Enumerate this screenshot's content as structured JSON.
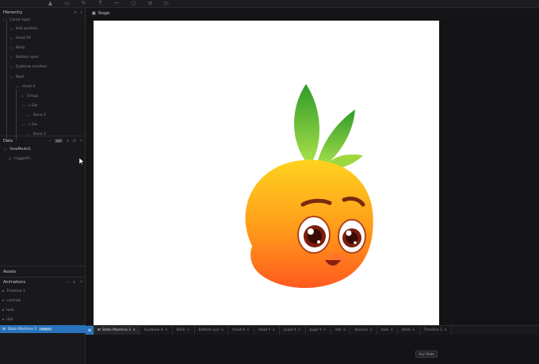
{
  "hierarchy": {
    "title": "Hierarchy",
    "items": [
      {
        "label": "Carrot topic",
        "icon": "artboard-icon"
      },
      {
        "label": "Ball position",
        "icon": "group-icon"
      },
      {
        "label": "Head XY",
        "icon": "group-icon"
      },
      {
        "label": "Body",
        "icon": "group-icon"
      },
      {
        "label": "Bottom eyes",
        "icon": "group-icon"
      },
      {
        "label": "Eyebrow emotion",
        "icon": "group-icon"
      },
      {
        "label": "Root",
        "icon": "bone-icon"
      },
      {
        "label": "Head X",
        "icon": "bone-icon"
      },
      {
        "label": "Group",
        "icon": "group-icon"
      },
      {
        "label": "L Ear",
        "icon": "bone-icon"
      },
      {
        "label": "Bone 2",
        "icon": "bone-icon"
      },
      {
        "label": "L Ear",
        "icon": "bone-icon"
      },
      {
        "label": "Bone 3",
        "icon": "bone-icon"
      }
    ]
  },
  "data_panel": {
    "title": "Data",
    "chip": "var",
    "viewmodel": "ViewModel1",
    "trigger": "triggerPr..."
  },
  "assets": {
    "title": "Assets"
  },
  "animations": {
    "title": "Animations",
    "items": [
      {
        "label": "Timeline 1",
        "selected": false
      },
      {
        "label": "controls",
        "selected": false
      },
      {
        "label": "look",
        "selected": false
      },
      {
        "label": "idle",
        "selected": false
      },
      {
        "label": "State Machine 1",
        "selected": true,
        "badge": "default"
      }
    ]
  },
  "stage": {
    "title": "Stage"
  },
  "tabs": [
    {
      "label": "State Machine 1",
      "active": true
    },
    {
      "label": "Eyebrow X",
      "active": false
    },
    {
      "label": "Blink",
      "active": false
    },
    {
      "label": "Bottom eye",
      "active": false
    },
    {
      "label": "head X",
      "active": false
    },
    {
      "label": "head Y",
      "active": false
    },
    {
      "label": "pupil X",
      "active": false
    },
    {
      "label": "pupil Y",
      "active": false
    },
    {
      "label": "idle",
      "active": false
    },
    {
      "label": "bounce",
      "active": false
    },
    {
      "label": "look",
      "active": false
    },
    {
      "label": "blink",
      "active": false
    },
    {
      "label": "Timeline 1",
      "active": false
    }
  ],
  "graph": {
    "any_state": "Any State"
  },
  "colors": {
    "accent": "#2a73bc",
    "fruit_top": "#ffd21e",
    "fruit_bottom": "#ff5a1f",
    "leaf": "#6cc63a"
  }
}
